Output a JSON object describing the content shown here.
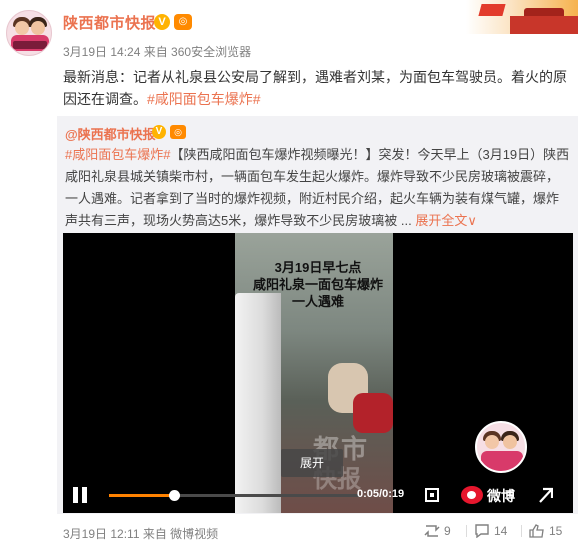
{
  "post": {
    "author": "陕西都市快报",
    "verified_mark": "V",
    "meta": "3月19日 14:24 来自 360安全浏览器",
    "text_before": "最新消息：记者从礼泉县公安局了解到，遇难者刘某，为面包车驾驶员。着火的原因还在调查。",
    "hashtag": "#咸阳面包车爆炸#"
  },
  "repost": {
    "author": "@陕西都市快报",
    "hashtag": "#咸阳面包车爆炸#",
    "text": "【陕西咸阳面包车爆炸视频曝光！】突发！今天早上（3月19日）陕西咸阳礼泉县城关镇柴市村，一辆面包车发生起火爆炸。爆炸导致不少民房玻璃被震碎，一人遇难。记者拿到了当时的爆炸视频，附近村民介绍，起火车辆为装有煤气罐，爆炸声共有三声，现场火势高达5米，爆炸导致不少民房玻璃被 ...",
    "full_text_link": "展开全文",
    "full_text_arrow": "∨"
  },
  "video": {
    "overlay_title_line1": "3月19日早七点",
    "overlay_title_line2": "咸阳礼泉一面包车爆炸",
    "overlay_title_line3": "一人遇难",
    "watermark_line1": "都市",
    "watermark_line2": "快报",
    "expand_label": "展开",
    "time": "0:05/0:19",
    "progress": 0.26,
    "brand": "微博"
  },
  "footer": {
    "meta": "3月19日 12:11 来自 微博视频",
    "repost_count": "9",
    "comment_count": "14",
    "like_count": "15"
  },
  "colors": {
    "accent": "#eb7350",
    "progress": "#ff8200",
    "weibo_red": "#e6162d"
  }
}
